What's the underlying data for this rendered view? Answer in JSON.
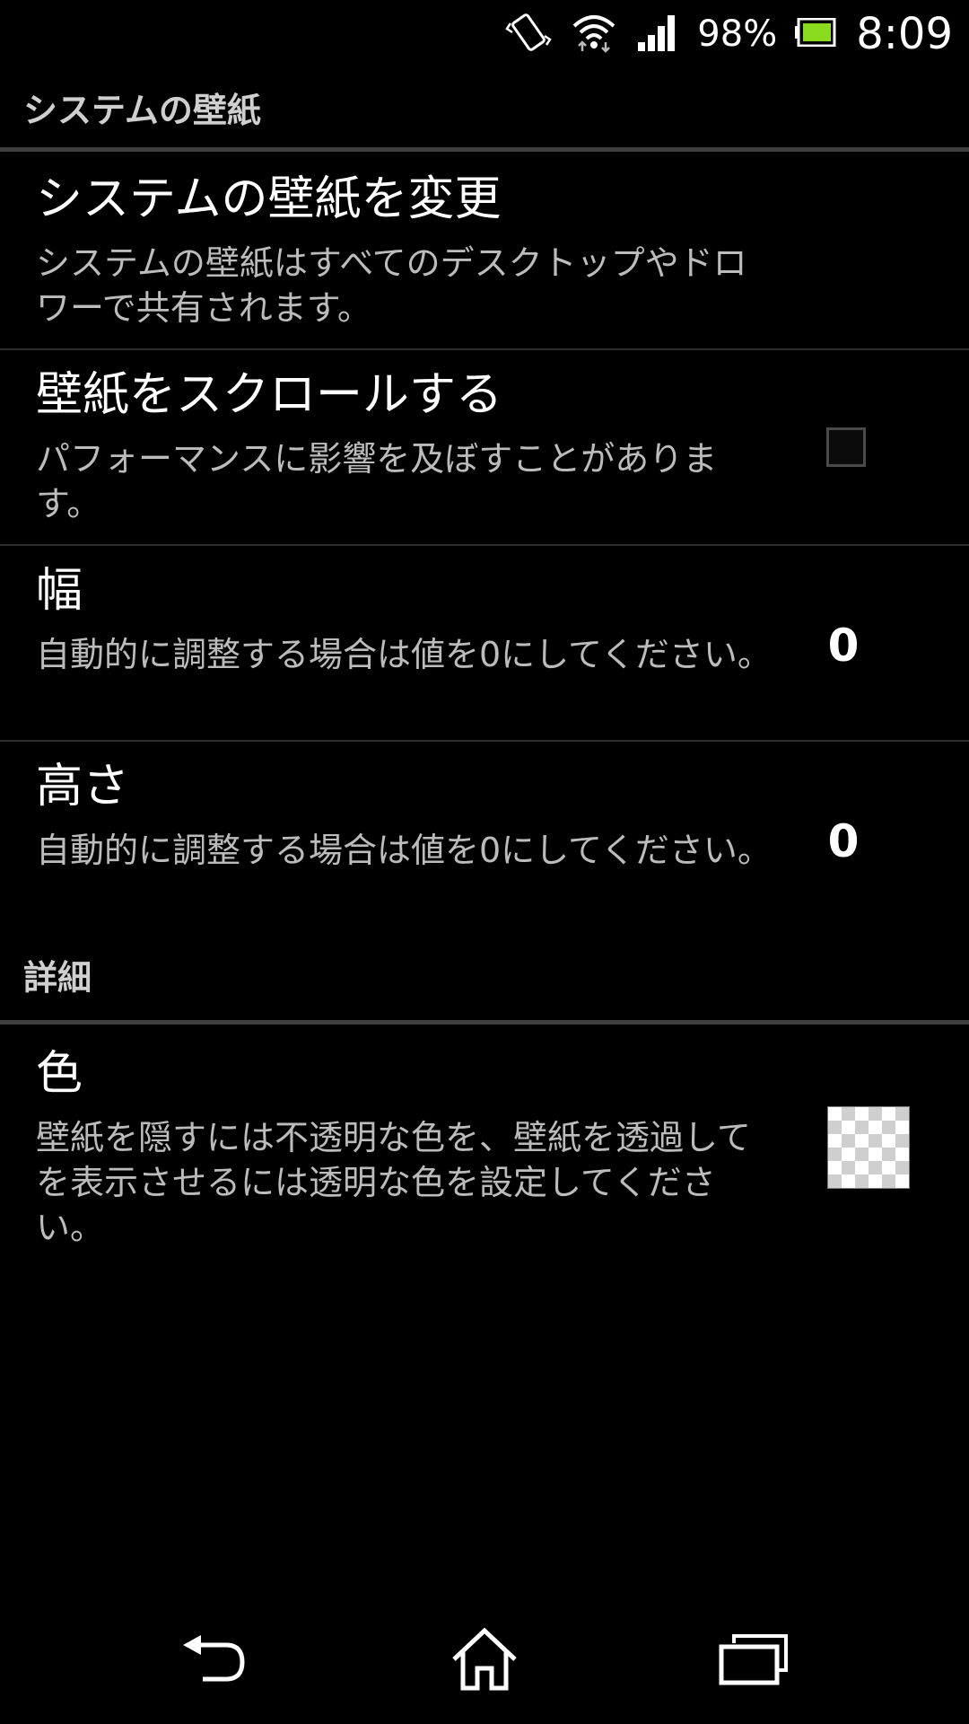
{
  "status_bar": {
    "battery_percent": "98%",
    "time": "8:09",
    "icons": [
      "vibrate-icon",
      "wifi-icon",
      "signal-icon",
      "battery-icon"
    ],
    "battery_color": "#8bdc1e"
  },
  "sections": {
    "system_wallpaper": {
      "header": "システムの壁紙",
      "items": {
        "change": {
          "title": "システムの壁紙を変更",
          "summary": "システムの壁紙はすべてのデスクトップやドロワーで共有されます。"
        },
        "scroll": {
          "title": "壁紙をスクロールする",
          "summary": "パフォーマンスに影響を及ぼすことがあります。",
          "checked": false
        },
        "width": {
          "title": "幅",
          "summary": "自動的に調整する場合は値を0にしてください。",
          "value": "0"
        },
        "height": {
          "title": "高さ",
          "summary": "自動的に調整する場合は値を0にしてください。",
          "value": "0"
        }
      }
    },
    "details": {
      "header": "詳細",
      "items": {
        "color": {
          "title": "色",
          "summary": "壁紙を隠すには不透明な色を、壁紙を透過してを表示させるには透明な色を設定してください。",
          "swatch": "transparent"
        }
      }
    }
  },
  "nav_bar": {
    "icons": [
      "back-icon",
      "home-icon",
      "recent-apps-icon"
    ]
  },
  "colors": {
    "background": "#000000",
    "header_text": "#cfcfcf",
    "summary_text": "#bcbcbc",
    "divider": "#3f3f3f"
  }
}
